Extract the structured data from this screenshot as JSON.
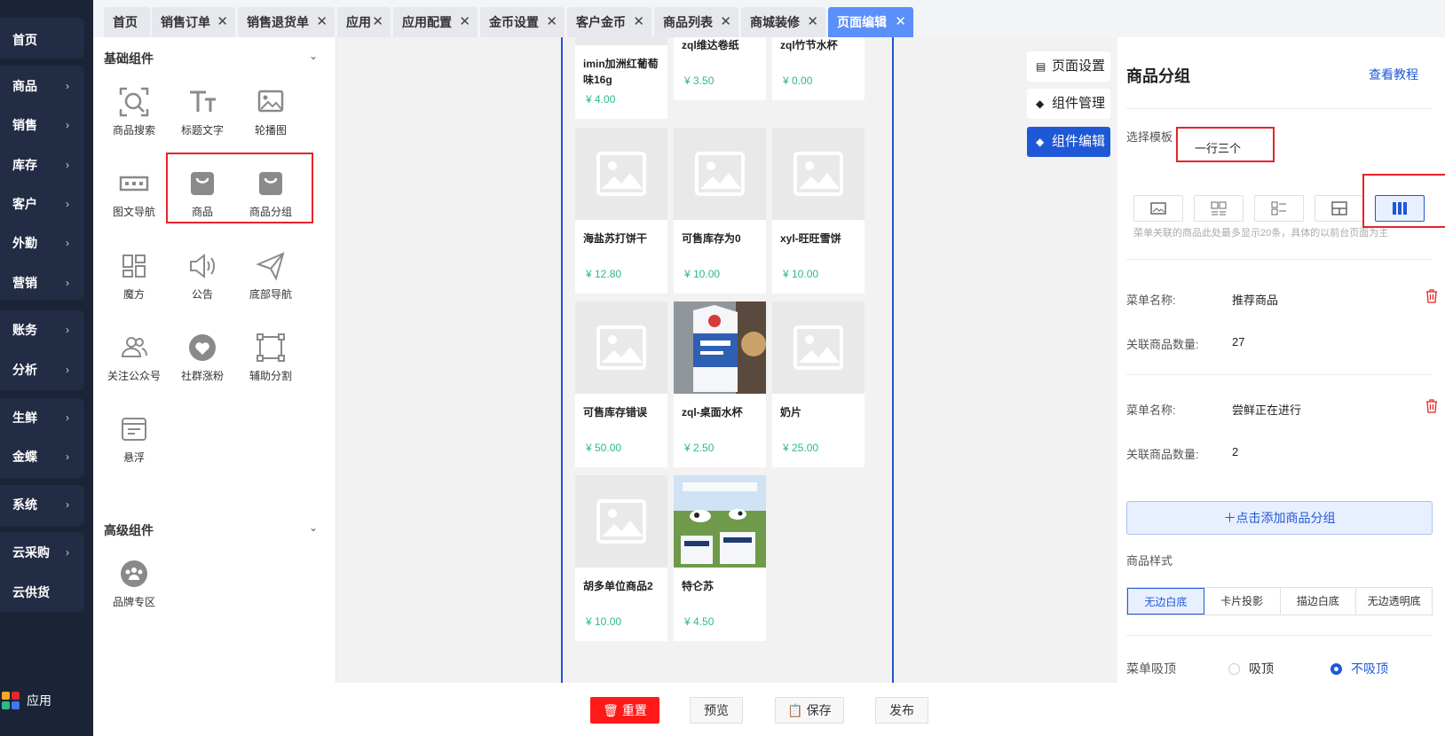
{
  "sidebar": {
    "items": [
      {
        "label": "首页",
        "chev": ""
      },
      {
        "label": "商品",
        "chev": "›"
      },
      {
        "label": "销售",
        "chev": "›"
      },
      {
        "label": "库存",
        "chev": "›"
      },
      {
        "label": "客户",
        "chev": "›"
      },
      {
        "label": "外勤",
        "chev": "›"
      },
      {
        "label": "营销",
        "chev": "›"
      },
      {
        "label": "账务",
        "chev": "›"
      },
      {
        "label": "分析",
        "chev": "›"
      },
      {
        "label": "生鲜",
        "chev": "›"
      },
      {
        "label": "金蝶",
        "chev": "›"
      },
      {
        "label": "系统",
        "chev": "›"
      },
      {
        "label": "云采购",
        "chev": "›"
      },
      {
        "label": "云供货",
        "chev": ""
      }
    ],
    "app_label": "应用"
  },
  "tabs": [
    {
      "label": "首页",
      "close": ""
    },
    {
      "label": "销售订单",
      "close": "✕"
    },
    {
      "label": "销售退货单",
      "close": "✕"
    },
    {
      "label": "应用",
      "close": "✕"
    },
    {
      "label": "应用配置",
      "close": "✕"
    },
    {
      "label": "金币设置",
      "close": "✕"
    },
    {
      "label": "客户金币",
      "close": "✕"
    },
    {
      "label": "商品列表",
      "close": "✕"
    },
    {
      "label": "商城装修",
      "close": "✕"
    },
    {
      "label": "页面编辑",
      "close": "✕"
    }
  ],
  "components": {
    "basic_title": "基础组件",
    "advanced_title": "高级组件",
    "chevron": "⌄",
    "basic": [
      {
        "label": "商品搜索",
        "icon": "search-frame-icon"
      },
      {
        "label": "标题文字",
        "icon": "text-title-icon"
      },
      {
        "label": "轮播图",
        "icon": "image-carousel-icon"
      },
      {
        "label": "图文导航",
        "icon": "image-nav-icon"
      },
      {
        "label": "商品",
        "icon": "shopping-bag-icon"
      },
      {
        "label": "商品分组",
        "icon": "shopping-bag-icon"
      },
      {
        "label": "魔方",
        "icon": "cube-grid-icon"
      },
      {
        "label": "公告",
        "icon": "speaker-icon"
      },
      {
        "label": "底部导航",
        "icon": "paper-plane-icon"
      },
      {
        "label": "关注公众号",
        "icon": "users-icon"
      },
      {
        "label": "社群涨粉",
        "icon": "heart-plus-icon"
      },
      {
        "label": "辅助分割",
        "icon": "divider-frame-icon"
      },
      {
        "label": "悬浮",
        "icon": "float-window-icon"
      }
    ],
    "advanced": [
      {
        "label": "品牌专区",
        "icon": "brand-people-icon"
      }
    ]
  },
  "products": [
    {
      "name": "imin加洲红葡萄味16g",
      "price": "¥ 4.00",
      "image": "none"
    },
    {
      "name": "zql维达卷纸",
      "price": "¥ 3.50",
      "image": "none"
    },
    {
      "name": "zql竹节水杯",
      "price": "¥ 0.00",
      "image": "none"
    },
    {
      "name": "海盐苏打饼干",
      "price": "¥ 12.80",
      "image": "placeholder"
    },
    {
      "name": "可售库存为0",
      "price": "¥ 10.00",
      "image": "placeholder"
    },
    {
      "name": "xyl-旺旺雪饼",
      "price": "¥ 10.00",
      "image": "placeholder"
    },
    {
      "name": "可售库存错误",
      "price": "¥ 50.00",
      "image": "placeholder"
    },
    {
      "name": "zql-桌面水杯",
      "price": "¥ 2.50",
      "image": "milk-carton"
    },
    {
      "name": "奶片",
      "price": "¥ 25.00",
      "image": "placeholder"
    },
    {
      "name": "胡多单位商品2",
      "price": "¥ 10.00",
      "image": "placeholder"
    },
    {
      "name": "特仑苏",
      "price": "¥ 4.50",
      "image": "cows"
    }
  ],
  "side_tabs": [
    {
      "label": "页面设置",
      "icon": "page-icon"
    },
    {
      "label": "组件管理",
      "icon": "layers-icon"
    },
    {
      "label": "组件编辑",
      "icon": "layers-icon"
    }
  ],
  "settings": {
    "title": "商品分组",
    "tutorial_link": "查看教程",
    "template_label": "选择模板",
    "template_value": "一行三个",
    "template_options": [
      "big-image-icon",
      "two-per-row-icon",
      "list-icon",
      "mixed-layout-icon",
      "three-per-row-icon"
    ],
    "hint": "菜单关联的商品此处最多显示20条，具体的以前台页面为主",
    "menus": [
      {
        "name_label": "菜单名称:",
        "name": "推荐商品",
        "count_label": "关联商品数量:",
        "count": "27"
      },
      {
        "name_label": "菜单名称:",
        "name": "尝鲜正在进行",
        "count_label": "关联商品数量:",
        "count": "2"
      }
    ],
    "add_group": "＋点击添加商品分组",
    "style_label": "商品样式",
    "styles": [
      "无边白底",
      "卡片投影",
      "描边白底",
      "无边透明底"
    ],
    "sticky_label": "菜单吸顶",
    "sticky_options": [
      "吸顶",
      "不吸顶"
    ],
    "sticky_selected": "不吸顶",
    "style_selected": "无边白底"
  },
  "bottom": {
    "reset": "重置",
    "preview": "预览",
    "save": "保存",
    "publish": "发布"
  },
  "colors": {
    "sidebar_bg": "#1b2336",
    "accent": "#1f58d6",
    "active_tab": "#5b8ff9",
    "price": "#2eb88a",
    "danger": "#e5242b"
  }
}
